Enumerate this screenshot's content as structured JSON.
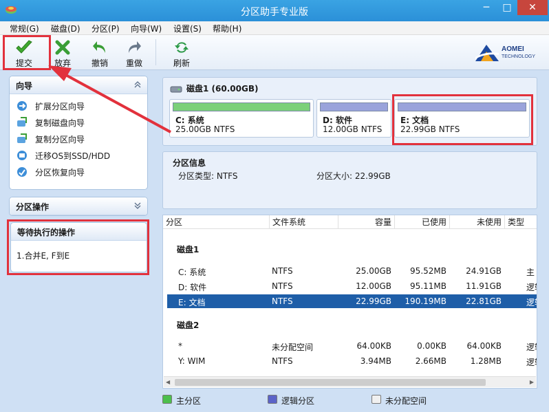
{
  "window": {
    "title": "分区助手专业版",
    "min_glyph": "─",
    "max_glyph": "□",
    "close_glyph": "✕"
  },
  "menu": [
    "常规(G)",
    "磁盘(D)",
    "分区(P)",
    "向导(W)",
    "设置(S)",
    "帮助(H)"
  ],
  "toolbar": {
    "commit": "提交",
    "discard": "放弃",
    "undo": "撤销",
    "redo": "重做",
    "refresh": "刷新"
  },
  "brand": {
    "name": "AOMEI",
    "sub": "TECHNOLOGY"
  },
  "wizard_panel": {
    "title": "向导",
    "items": [
      "扩展分区向导",
      "复制磁盘向导",
      "复制分区向导",
      "迁移OS到SSD/HDD",
      "分区恢复向导"
    ]
  },
  "partition_ops_panel": {
    "title": "分区操作"
  },
  "pending_panel": {
    "title": "等待执行的操作",
    "items": [
      "1.合并E, F到E"
    ]
  },
  "disk_map": {
    "title": "磁盘1 (60.00GB)",
    "partitions": [
      {
        "name": "C: 系统",
        "size": "25.00GB NTFS",
        "bar_color": "#7cd07a"
      },
      {
        "name": "D: 软件",
        "size": "12.00GB NTFS",
        "bar_color": "#9aa3db"
      },
      {
        "name": "E: 文档",
        "size": "22.99GB NTFS",
        "bar_color": "#9aa3db"
      }
    ]
  },
  "partition_info": {
    "title": "分区信息",
    "type_label": "分区类型: NTFS",
    "size_label": "分区大小: 22.99GB"
  },
  "table": {
    "columns": [
      "分区",
      "文件系统",
      "容量",
      "已使用",
      "未使用",
      "类型"
    ],
    "groups": [
      {
        "label": "磁盘1",
        "rows": [
          {
            "part": "C: 系统",
            "fs": "NTFS",
            "cap": "25.00GB",
            "used": "95.52MB",
            "free": "24.91GB",
            "type": "主",
            "selected": false
          },
          {
            "part": "D: 软件",
            "fs": "NTFS",
            "cap": "12.00GB",
            "used": "95.11MB",
            "free": "11.91GB",
            "type": "逻辑",
            "selected": false
          },
          {
            "part": "E: 文档",
            "fs": "NTFS",
            "cap": "22.99GB",
            "used": "190.19MB",
            "free": "22.81GB",
            "type": "逻辑",
            "selected": true
          }
        ]
      },
      {
        "label": "磁盘2",
        "rows": [
          {
            "part": "*",
            "fs": "未分配空间",
            "cap": "64.00KB",
            "used": "0.00KB",
            "free": "64.00KB",
            "type": "逻辑",
            "selected": false
          },
          {
            "part": "Y: WIM",
            "fs": "NTFS",
            "cap": "3.94MB",
            "used": "2.66MB",
            "free": "1.28MB",
            "type": "逻辑",
            "selected": false
          }
        ]
      }
    ]
  },
  "legend": [
    {
      "label": "主分区",
      "color": "#4cbf4c"
    },
    {
      "label": "逻辑分区",
      "color": "#5b63c8"
    },
    {
      "label": "未分配空间",
      "color": "#f0f0f0"
    }
  ],
  "colors": {
    "accent_red": "#e2313c",
    "selection": "#1e5ea8",
    "titlebar": "#2b90d8"
  }
}
